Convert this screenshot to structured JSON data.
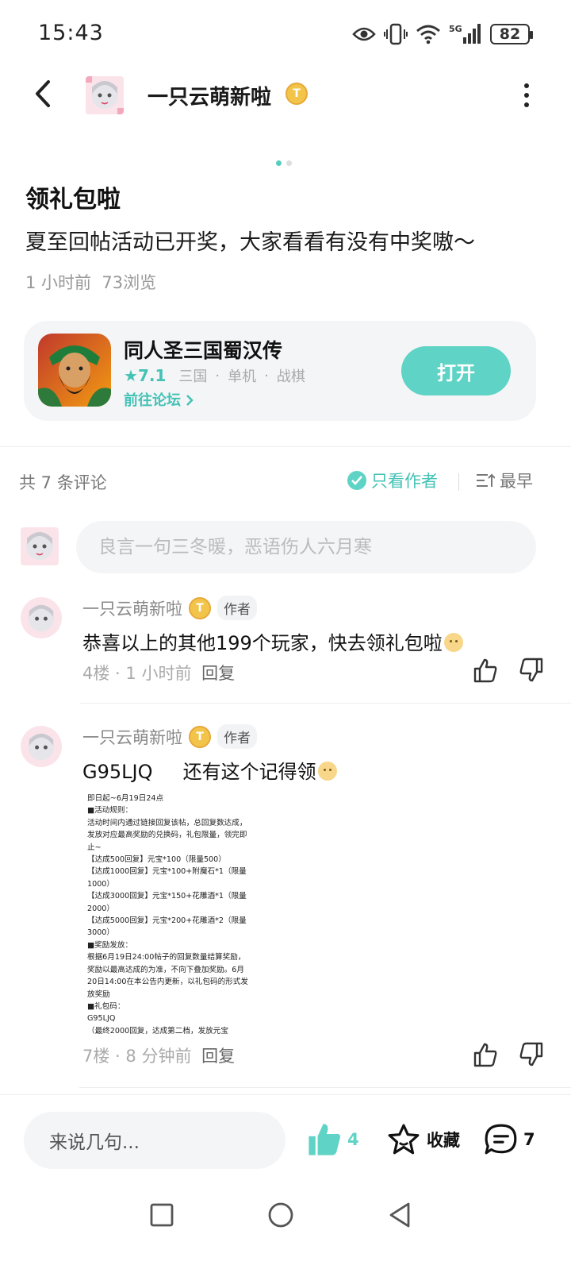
{
  "status_bar": {
    "time": "15:43",
    "battery": "82"
  },
  "header": {
    "title": "一只云萌新啦",
    "coin_badge": "T"
  },
  "post": {
    "title": "领礼包啦",
    "body": "夏至回帖活动已开奖，大家看看有没有中奖嗷～",
    "time": "1 小时前",
    "views": "73浏览"
  },
  "game_card": {
    "name": "同人圣三国蜀汉传",
    "rating": "7.1",
    "tags": [
      "三国",
      "单机",
      "战棋"
    ],
    "forum_link": "前往论坛",
    "open_button": "打开"
  },
  "comments_bar": {
    "count_label": "共 7 条评论",
    "author_only": "只看作者",
    "sort": "最早"
  },
  "comment_input": {
    "placeholder": "良言一句三冬暖，恶语伤人六月寒"
  },
  "comments": [
    {
      "name": "一只云萌新啦",
      "tag": "作者",
      "text": "恭喜以上的其他199个玩家，快去领礼包啦",
      "floor": "4楼",
      "time": "1 小时前",
      "reply": "回复"
    },
    {
      "name": "一只云萌新啦",
      "tag": "作者",
      "text": "G95LJQ     还有这个记得领",
      "floor": "7楼",
      "time": "8 分钟前",
      "reply": "回复",
      "image_text": "即日起~6月19日24点\n■活动规则：\n活动时间内通过链接回复该帖，总回复数达成，\n发放对应最高奖励的兑换码，礼包限量，领完即\n止~\n【达成500回复】元宝*100（限量500）\n【达成1000回复】元宝*100+附魔石*1（限量\n1000）\n【达成3000回复】元宝*150+花雕酒*1（限量\n2000）\n【达成5000回复】元宝*200+花雕酒*2（限量\n3000）\n■奖励发放：\n根据6月19日24:00帖子的回复数量结算奖励，\n奖励以最高达成的为准，不向下叠加奖励。6月\n20日14:00在本公告内更新，以礼包码的形式发\n放奖励\n■礼包码：\nG95LJQ\n（最终2000回复，达成第二档，发放元宝"
    }
  ],
  "bottom_bar": {
    "say_placeholder": "来说几句...",
    "likes": "4",
    "favorite": "收藏",
    "comments": "7"
  },
  "colors": {
    "accent": "#5fd3c5",
    "accent_text": "#43c2b5",
    "coin": "#f3c44a"
  }
}
